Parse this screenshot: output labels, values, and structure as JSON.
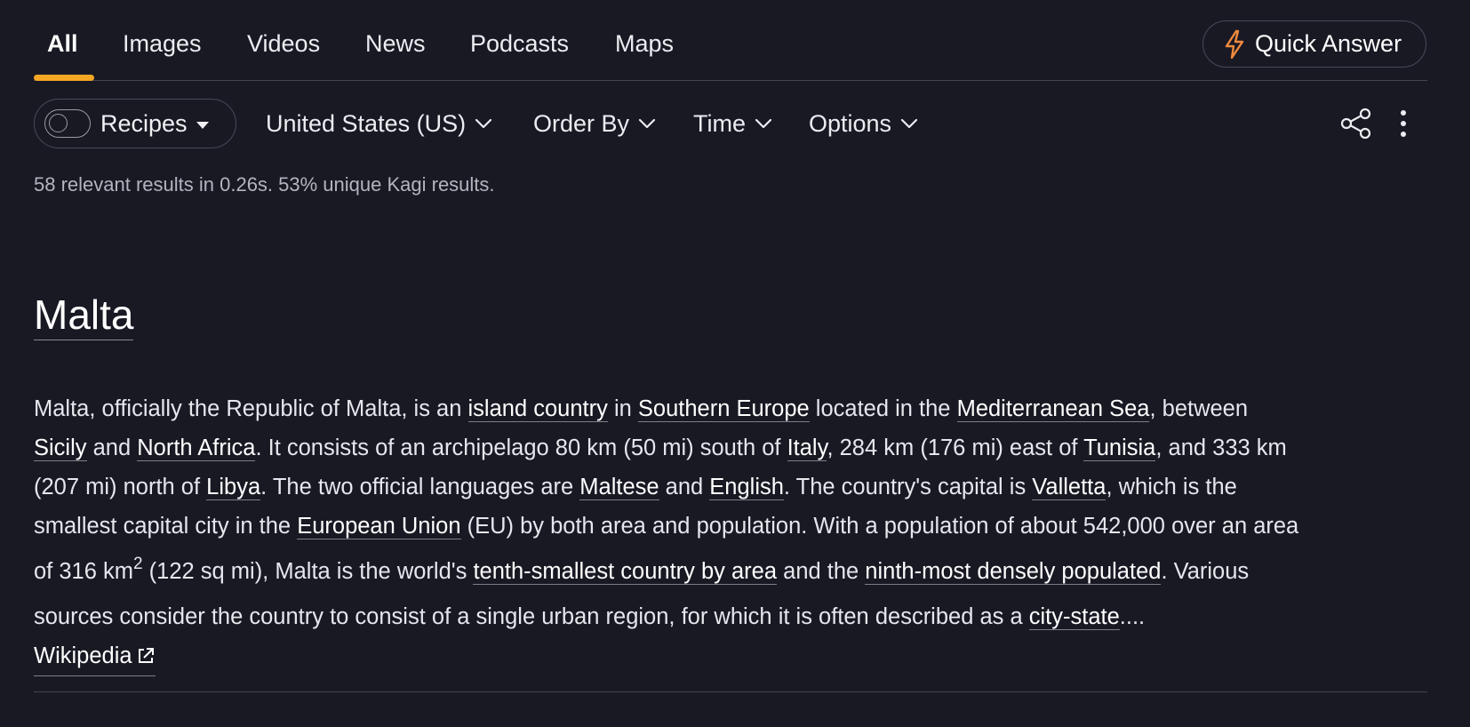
{
  "tabs": [
    {
      "label": "All",
      "active": true
    },
    {
      "label": "Images"
    },
    {
      "label": "Videos"
    },
    {
      "label": "News"
    },
    {
      "label": "Podcasts"
    },
    {
      "label": "Maps"
    }
  ],
  "quick_answer": {
    "label": "Quick Answer",
    "icon": "bolt-icon",
    "icon_color": "#f08a3c"
  },
  "accent_color": "#f5a623",
  "filters": {
    "recipes": {
      "label": "Recipes",
      "toggle_on": false
    },
    "region": "United States (US)",
    "order_by": "Order By",
    "time": "Time",
    "options": "Options"
  },
  "stats": "58 relevant results in 0.26s. 53% unique Kagi results.",
  "knowledge_panel": {
    "title": "Malta",
    "segments": {
      "l1_a": "Malta, officially the Republic of Malta, is an ",
      "l1_link1": "island country",
      "l1_b": " in ",
      "l1_link2": "Southern Europe",
      "l1_c": " located in the ",
      "l1_link3": "Mediterranean Sea",
      "l1_d": ", between",
      "l2_link1": "Sicily",
      "l2_a": " and ",
      "l2_link2": "North Africa",
      "l2_b": ". It consists of an archipelago 80 km (50 mi) south of ",
      "l2_link3": "Italy",
      "l2_c": ", 284 km (176 mi) east of ",
      "l2_link4": "Tunisia",
      "l2_d": ", and 333 km",
      "l3_a": "(207 mi) north of ",
      "l3_link1": "Libya",
      "l3_b": ". The two official languages are ",
      "l3_link2": "Maltese",
      "l3_c": " and ",
      "l3_link3": "English",
      "l3_d": ". The country's capital is ",
      "l3_link4": "Valletta",
      "l3_e": ", which is the",
      "l4_a": "smallest capital city in the ",
      "l4_link1": "European Union",
      "l4_b": " (EU) by both area and population. With a population of about 542,000 over an area",
      "l5_a": "of 316 km",
      "l5_sup": "2",
      "l5_b": " (122 sq mi), Malta is the world's ",
      "l5_link1": "tenth-smallest country by area",
      "l5_c": " and the ",
      "l5_link2": "ninth-most densely populated",
      "l5_d": ". Various",
      "l6_a": "sources consider the country to consist of a single urban region, for which it is often described as a ",
      "l6_link1": "city-state",
      "l6_b": "...."
    },
    "source_link": "Wikipedia"
  }
}
